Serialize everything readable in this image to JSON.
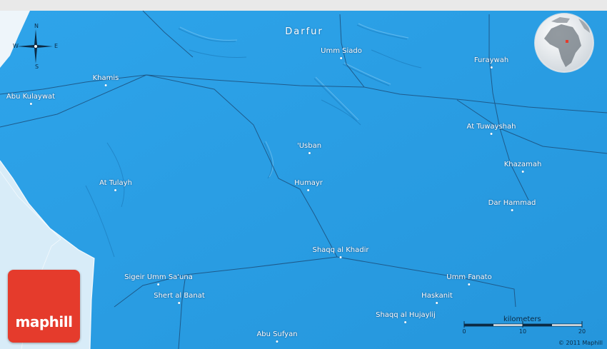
{
  "map": {
    "region_label": "Darfur",
    "places": [
      {
        "name": "Umm Siado"
      },
      {
        "name": "Khamis"
      },
      {
        "name": "Abu Kulaywat"
      },
      {
        "name": "Furaywah"
      },
      {
        "name": "At Tuwayshah"
      },
      {
        "name": "'Usban"
      },
      {
        "name": "Khazamah"
      },
      {
        "name": "At Tulayh"
      },
      {
        "name": "Humayr"
      },
      {
        "name": "Dar Hammad"
      },
      {
        "name": "Shaqq al Khadir"
      },
      {
        "name": "Sigeir Umm Sa'una"
      },
      {
        "name": "Umm Fanato"
      },
      {
        "name": "Shert al Banat"
      },
      {
        "name": "Haskanit"
      },
      {
        "name": "Shaqq al Hujaylij"
      },
      {
        "name": "Abu Sufyan"
      }
    ],
    "colors": {
      "water": "#2ba0e6",
      "land_outside": "#eef5fa",
      "road": "#1c4f7c",
      "label_text": "#ffffff",
      "brand_red": "#e53b2c"
    }
  },
  "compass": {
    "north": "N",
    "south": "S",
    "east": "E",
    "west": "W"
  },
  "brand": {
    "logo_text": "maphill"
  },
  "scale": {
    "title": "kilometers",
    "ticks": [
      "0",
      "10",
      "20"
    ]
  },
  "copyright": "© 2011 Maphill",
  "globe": {
    "icon": "globe-africa-locator-icon"
  }
}
